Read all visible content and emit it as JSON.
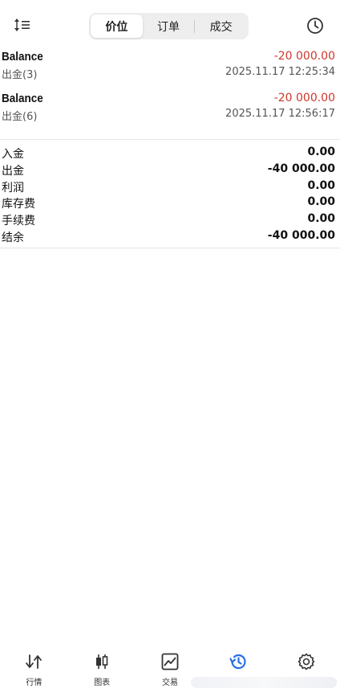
{
  "header": {
    "tabs": [
      {
        "label": "价位",
        "active": true
      },
      {
        "label": "订单",
        "active": false
      },
      {
        "label": "成交",
        "active": false
      }
    ],
    "left_icon": "sort-icon",
    "right_icon": "clock-icon"
  },
  "deals": [
    {
      "title": "Balance",
      "subtitle": "出金(3)",
      "amount": "-20 000.00",
      "time": "2025.11.17 12:25:34"
    },
    {
      "title": "Balance",
      "subtitle": "出金(6)",
      "amount": "-20 000.00",
      "time": "2025.11.17 12:56:17"
    }
  ],
  "summary": [
    {
      "label": "入金",
      "value": "0.00"
    },
    {
      "label": "出金",
      "value": "-40 000.00"
    },
    {
      "label": "利润",
      "value": "0.00"
    },
    {
      "label": "库存费",
      "value": "0.00"
    },
    {
      "label": "手续费",
      "value": "0.00"
    },
    {
      "label": "结余",
      "value": "-40 000.00"
    }
  ],
  "bottom_nav": [
    {
      "label": "行情",
      "icon": "quotes-icon",
      "active": false
    },
    {
      "label": "图表",
      "icon": "chart-icon",
      "active": false
    },
    {
      "label": "交易",
      "icon": "trade-icon",
      "active": false
    },
    {
      "label": "",
      "icon": "history-icon",
      "active": true
    },
    {
      "label": "",
      "icon": "settings-icon",
      "active": false
    }
  ],
  "colors": {
    "accent": "#2b6fe6",
    "negative": "#d0372b"
  }
}
